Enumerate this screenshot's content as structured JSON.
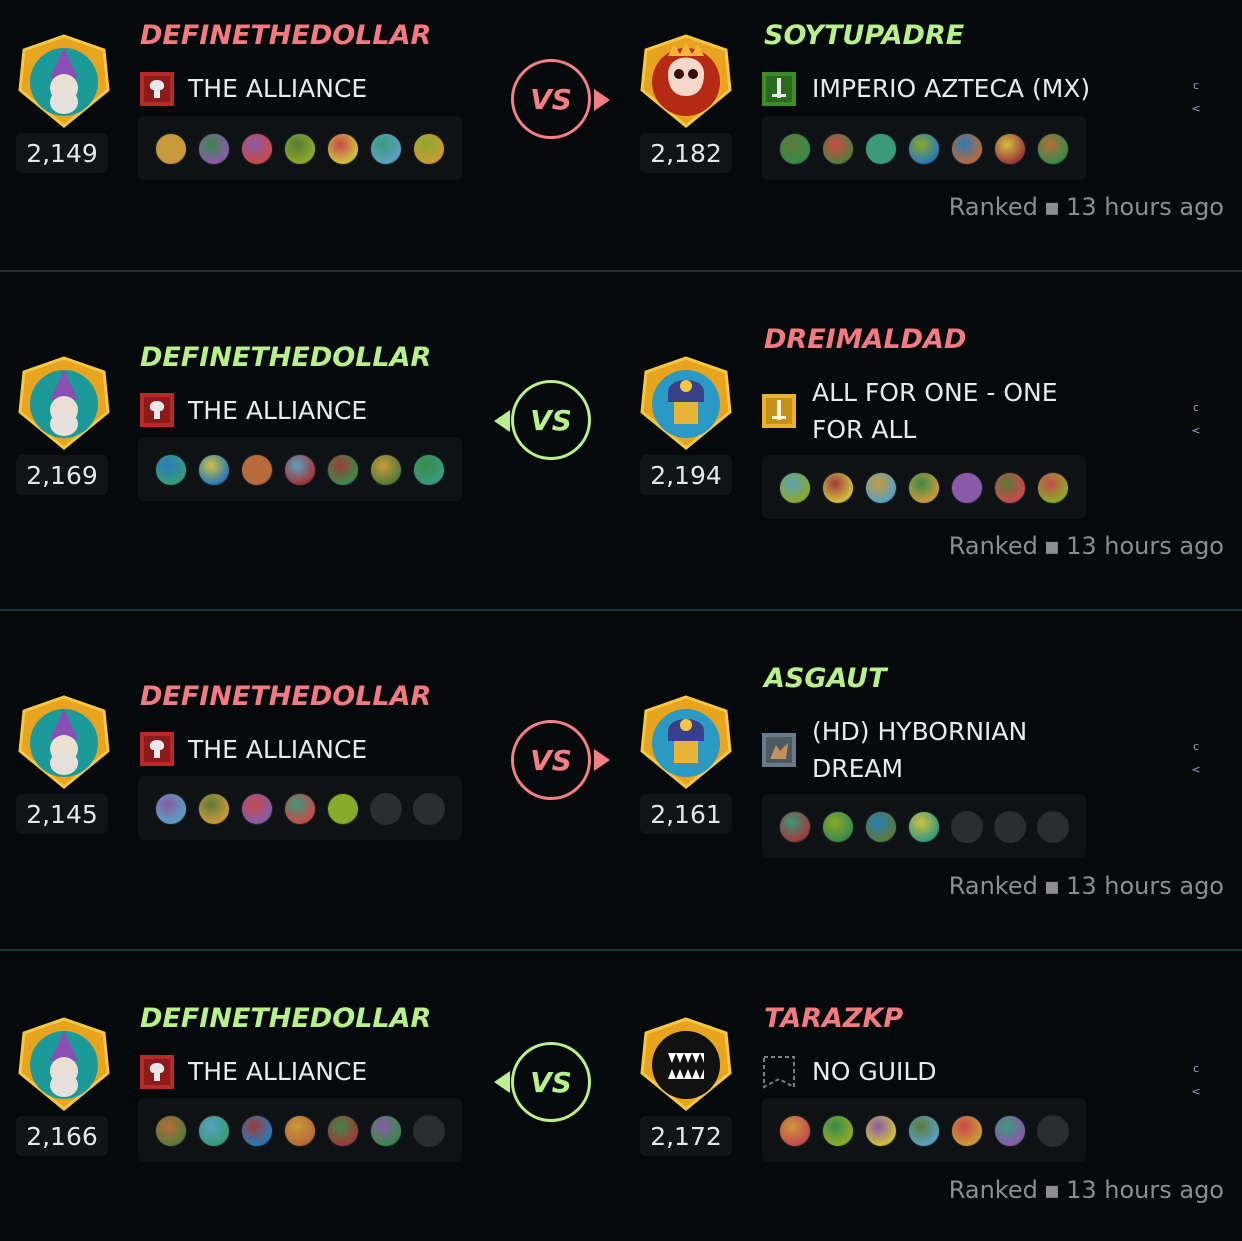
{
  "colors": {
    "winner": "#e6f07a",
    "loser": "#f47f84",
    "green_name": "#b8f08a",
    "red_name": "#f27a80"
  },
  "battles": [
    {
      "left": {
        "name": "DEFINETHEDOLLAR",
        "name_color": "red",
        "guild": "THE ALLIANCE",
        "guild_icon": "red-tree-banner-icon",
        "rating": "2,149",
        "avatar": "wizard-avatar"
      },
      "right": {
        "name": "SOYTUPADRE",
        "name_color": "green",
        "guild": "IMPERIO AZTECA (MX)",
        "guild_icon": "green-sword-banner-icon",
        "rating": "2,182",
        "avatar": "fire-skull-avatar"
      },
      "vs_direction": "right",
      "mode": "Ranked",
      "time": "13 hours ago",
      "left_units": [
        "u",
        "u",
        "u",
        "u",
        "u",
        "u",
        "u"
      ],
      "right_units": [
        "u",
        "u",
        "u",
        "u",
        "u",
        "u",
        "u"
      ]
    },
    {
      "left": {
        "name": "DEFINETHEDOLLAR",
        "name_color": "green",
        "guild": "THE ALLIANCE",
        "guild_icon": "red-tree-banner-icon",
        "rating": "2,169",
        "avatar": "wizard-avatar"
      },
      "right": {
        "name": "DREIMALDAD",
        "name_color": "red",
        "guild": "ALL FOR ONE - ONE FOR ALL",
        "guild_icon": "gold-sword-banner-icon",
        "rating": "2,194",
        "avatar": "blue-knight-avatar"
      },
      "vs_direction": "left",
      "mode": "Ranked",
      "time": "13 hours ago",
      "left_units": [
        "u",
        "u",
        "u",
        "u",
        "u",
        "u",
        "u"
      ],
      "right_units": [
        "u",
        "u",
        "u",
        "u",
        "u",
        "u",
        "u"
      ]
    },
    {
      "left": {
        "name": "DEFINETHEDOLLAR",
        "name_color": "red",
        "guild": "THE ALLIANCE",
        "guild_icon": "red-tree-banner-icon",
        "rating": "2,145",
        "avatar": "wizard-avatar"
      },
      "right": {
        "name": "ASGAUT",
        "name_color": "green",
        "guild": "(HD) HYBORNIAN DREAM",
        "guild_icon": "wolf-banner-icon",
        "rating": "2,161",
        "avatar": "blue-knight-avatar"
      },
      "vs_direction": "right",
      "mode": "Ranked",
      "time": "13 hours ago",
      "left_units": [
        "u",
        "u",
        "u",
        "u",
        "u",
        "empty",
        "empty"
      ],
      "right_units": [
        "u",
        "u",
        "u",
        "u",
        "empty",
        "empty",
        "empty"
      ]
    },
    {
      "left": {
        "name": "DEFINETHEDOLLAR",
        "name_color": "green",
        "guild": "THE ALLIANCE",
        "guild_icon": "red-tree-banner-icon",
        "rating": "2,166",
        "avatar": "wizard-avatar"
      },
      "right": {
        "name": "TARAZKP",
        "name_color": "red",
        "guild": "NO GUILD",
        "guild_icon": "empty-banner-icon",
        "rating": "2,172",
        "avatar": "fanged-mouth-avatar"
      },
      "vs_direction": "left",
      "mode": "Ranked",
      "time": "13 hours ago",
      "left_units": [
        "u",
        "u",
        "u",
        "u",
        "u",
        "u",
        "empty"
      ],
      "right_units": [
        "u",
        "u",
        "u",
        "u",
        "u",
        "u",
        "empty"
      ]
    }
  ],
  "vs_label": "VS",
  "menu_glyph_top": "c",
  "menu_glyph_bottom": "<"
}
